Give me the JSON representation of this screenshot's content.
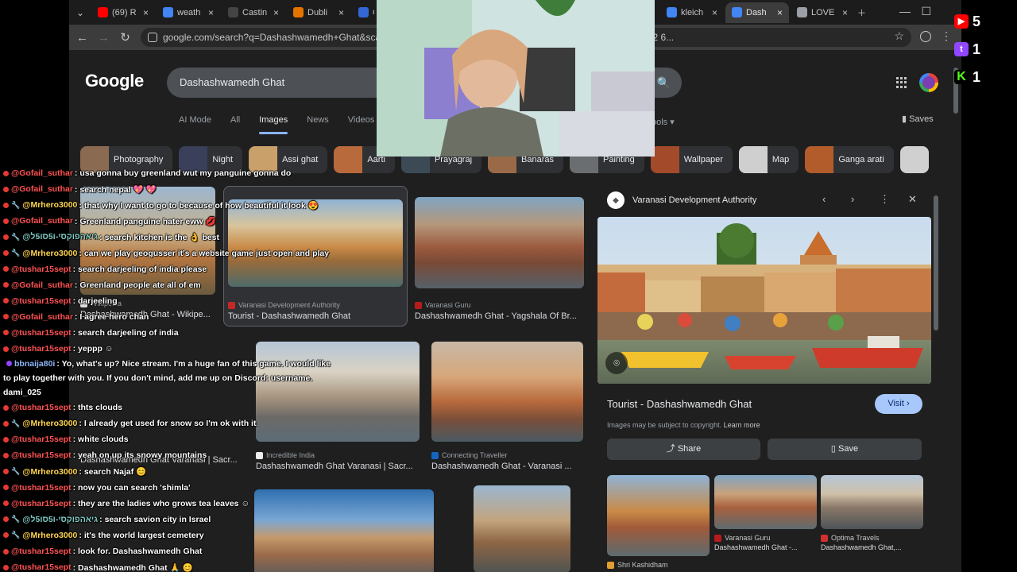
{
  "browser": {
    "tabs": [
      {
        "label": "(69) R",
        "favicon": "youtube-icon",
        "color": "#ff0000",
        "active": false
      },
      {
        "label": "weath",
        "favicon": "google-icon",
        "color": "#4285f4",
        "active": false
      },
      {
        "label": "Castin",
        "favicon": "casting-icon",
        "color": "#444444",
        "active": false
      },
      {
        "label": "Dubli",
        "favicon": "map-pin-icon",
        "color": "#e37400",
        "active": false
      },
      {
        "label": "Ga",
        "favicon": "generic-icon",
        "color": "#3367d6",
        "active": false
      },
      {
        "label": "kleich",
        "favicon": "google-icon",
        "color": "#4285f4",
        "active": false
      },
      {
        "label": "Dash",
        "favicon": "google-icon",
        "color": "#4285f4",
        "active": true
      },
      {
        "label": "LOVE",
        "favicon": "generic-icon",
        "color": "#9aa0a6",
        "active": false
      }
    ],
    "url": "google.com/search?q=Dashashwamedh+Ghat&sca_esv=...L-n7BkvcKznYAfmFvSNLGXNFkARk1fg%3A1769196172 6..."
  },
  "google": {
    "logo": "Google",
    "query": "Dashashwamedh Ghat",
    "nav": [
      "AI Mode",
      "All",
      "Images",
      "News",
      "Videos",
      "Fo"
    ],
    "active_nav": "Images",
    "tools": "ools",
    "saves": "Saves",
    "chips": [
      {
        "label": "Photography"
      },
      {
        "label": "Night"
      },
      {
        "label": "Assi ghat"
      },
      {
        "label": "Aarti"
      },
      {
        "label": "Prayagraj"
      },
      {
        "label": "Banaras"
      },
      {
        "label": "Painting"
      },
      {
        "label": "Wallpaper"
      },
      {
        "label": "Map"
      },
      {
        "label": "Ganga arati"
      }
    ]
  },
  "results": [
    {
      "source": "Wikipedia",
      "title": "Dashashwamedh Ghat - Wikipe..."
    },
    {
      "source": "Varanasi Development Authority",
      "title": "Tourist - Dashashwamedh Ghat"
    },
    {
      "source": "Varanasi Guru",
      "title": "Dashashwamedh Ghat - Yagshala Of Br..."
    },
    {
      "source": "Incredible India",
      "title": "Dashashwamedh Ghat Varanasi | Sacr..."
    },
    {
      "source": "Connecting Traveller",
      "title": "Dashashwamedh Ghat - Varanasi ..."
    },
    {
      "source": "",
      "title": "Dashashwamedh Ghat Varanasi | Sacr..."
    }
  ],
  "panel": {
    "source": "Varanasi Development Authority",
    "title": "Tourist - Dashashwamedh Ghat",
    "visit": "Visit",
    "copyright": "Images may be subject to copyright.",
    "learn_more": "Learn more",
    "share": "Share",
    "save": "Save",
    "related": [
      {
        "source": "Shri Kashidham",
        "title": ""
      },
      {
        "source": "Varanasi Guru",
        "title": "Dashashwamedh Ghat -..."
      },
      {
        "source": "Optima Travels",
        "title": "Dashashwamedh Ghat,..."
      }
    ]
  },
  "stream": {
    "youtube_count": "5",
    "twitch_count": "1",
    "kick_count": "1"
  },
  "chat": [
    {
      "user": "@Gofail_suthar",
      "text": ": usa gonna buy greenland wut my panguine gonna do",
      "badge": "#e53935",
      "color": "#ff5252",
      "mod": false
    },
    {
      "user": "@Gofail_suthar",
      "text": ": search nepal 💖 💖",
      "badge": "#e53935",
      "color": "#ff5252",
      "mod": false
    },
    {
      "user": "@Mrhero3000",
      "text": ": that why I want to go to because of how beautiful it look 😍",
      "badge": "#e53935",
      "color": "#ffd54f",
      "mod": true
    },
    {
      "user": "@Gofail_suthar",
      "text": ": Greenland panguine hater eww 💋",
      "badge": "#e53935",
      "color": "#ff5252",
      "mod": false
    },
    {
      "user": "@גיאהפוקסי-ו5סו5ל",
      "text": ": search kitchen is the 👌 best",
      "badge": "#e53935",
      "color": "#80cbc4",
      "mod": true
    },
    {
      "user": "@Mrhero3000",
      "text": ": can we play geogusser it's a website game just open and play",
      "badge": "#e53935",
      "color": "#ffd54f",
      "mod": true
    },
    {
      "user": "@tushar15sept",
      "text": ": search darjeeling of india please",
      "badge": "#e53935",
      "color": "#ff5252",
      "mod": false
    },
    {
      "user": "@Gofail_suthar",
      "text": ": Greenland people ate all of em",
      "badge": "#e53935",
      "color": "#ff5252",
      "mod": false
    },
    {
      "user": "@tushar15sept",
      "text": ": darjeeling",
      "badge": "#e53935",
      "color": "#ff5252",
      "mod": false
    },
    {
      "user": "@Gofail_suthar",
      "text": ": I agree hero chan",
      "badge": "#e53935",
      "color": "#ff5252",
      "mod": false
    },
    {
      "user": "@tushar15sept",
      "text": ": search darjeeling of india",
      "badge": "#e53935",
      "color": "#ff5252",
      "mod": false
    },
    {
      "user": "@tushar15sept",
      "text": ": yeppp ☺",
      "badge": "#e53935",
      "color": "#ff5252",
      "mod": false
    },
    {
      "user": "bbnaija80i",
      "text": ": Yo, what's up? Nice stream. I'm a huge fan of this game. I would like to play together with you. If you don't mind, add me up on Discord: username. dami_025",
      "badge": "#9146ff",
      "color": "#8ab4f8",
      "mod": false,
      "wrap": true
    },
    {
      "user": "@tushar15sept",
      "text": ": thts clouds",
      "badge": "#e53935",
      "color": "#ff5252",
      "mod": false
    },
    {
      "user": "@Mrhero3000",
      "text": ": I already get used for snow so I'm ok with it",
      "badge": "#e53935",
      "color": "#ffd54f",
      "mod": true
    },
    {
      "user": "@tushar15sept",
      "text": ": white clouds",
      "badge": "#e53935",
      "color": "#ff5252",
      "mod": false
    },
    {
      "user": "@tushar15sept",
      "text": ": yeah on up its snowy mountains",
      "badge": "#e53935",
      "color": "#ff5252",
      "mod": false
    },
    {
      "user": "@Mrhero3000",
      "text": ": search Najaf 😊",
      "badge": "#e53935",
      "color": "#ffd54f",
      "mod": true
    },
    {
      "user": "@tushar15sept",
      "text": ": now you can search 'shimla'",
      "badge": "#e53935",
      "color": "#ff5252",
      "mod": false
    },
    {
      "user": "@tushar15sept",
      "text": ": they are the ladies who grows tea leaves ☺",
      "badge": "#e53935",
      "color": "#ff5252",
      "mod": false
    },
    {
      "user": "@גיאהפוקסי-ו5סו5ל",
      "text": ": search savion city in Israel",
      "badge": "#e53935",
      "color": "#80cbc4",
      "mod": true
    },
    {
      "user": "@Mrhero3000",
      "text": ": it's the world largest cemetery",
      "badge": "#e53935",
      "color": "#ffd54f",
      "mod": true
    },
    {
      "user": "@tushar15sept",
      "text": ": look for. Dashashwamedh Ghat",
      "badge": "#e53935",
      "color": "#ff5252",
      "mod": false
    },
    {
      "user": "@tushar15sept",
      "text": ": Dashashwamedh Ghat 🙏 😊",
      "badge": "#e53935",
      "color": "#ff5252",
      "mod": false
    }
  ]
}
